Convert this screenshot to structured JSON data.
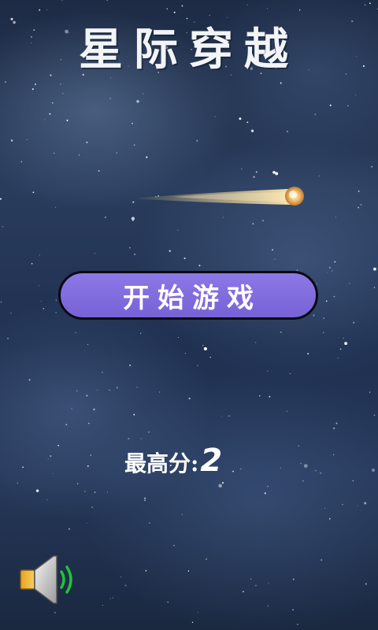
{
  "title": "星际穿越",
  "start_button": {
    "label": "开始游戏"
  },
  "high_score": {
    "label": "最高分",
    "separator": ":",
    "value": "2"
  },
  "sound": {
    "state": "on",
    "icon": "speaker-sound-on-icon"
  },
  "colors": {
    "button_fill": "#7f6ade",
    "button_border": "#0a0a12",
    "text": "#ffffff",
    "sound_waves": "#22c23a"
  }
}
